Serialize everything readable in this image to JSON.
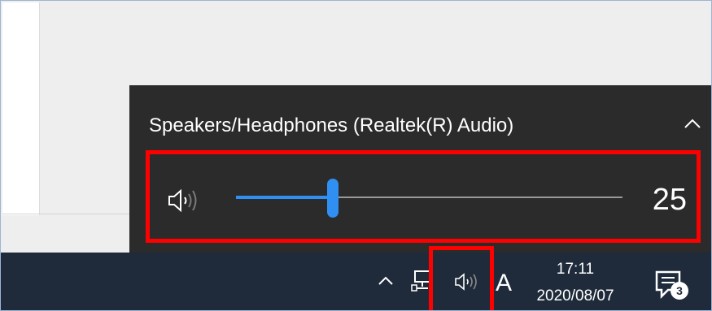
{
  "volume_flyout": {
    "device_name": "Speakers/Headphones (Realtek(R) Audio)",
    "volume_value": "25",
    "volume_level_percent": 25,
    "collapse_icon": "chevron-up-icon",
    "speaker_icon": "speaker-icon"
  },
  "taskbar": {
    "tray_chevron_icon": "chevron-up-icon",
    "network_icon": "network-icon",
    "volume_icon": "speaker-icon",
    "ime_label": "A",
    "time": "17:11",
    "date": "2020/08/07",
    "action_center_icon": "notifications-icon",
    "notification_count": "3"
  },
  "colors": {
    "highlight_box": "#ff0000",
    "slider_accent": "#2f8ff3",
    "flyout_bg": "#2b2b2b",
    "taskbar_bg": "#1f2b3a"
  }
}
